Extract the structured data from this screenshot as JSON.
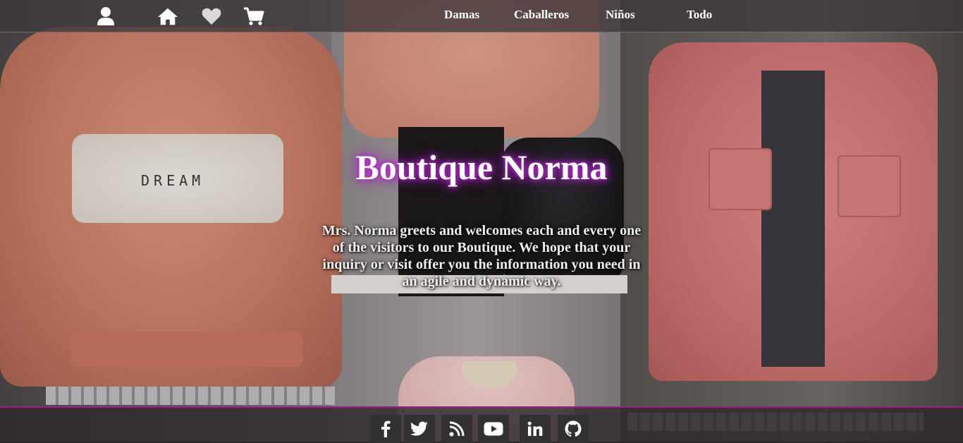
{
  "nav": {
    "icons": [
      "user-icon",
      "home-icon",
      "heart-icon",
      "cart-icon"
    ],
    "links": [
      "Damas",
      "Caballeros",
      "Niños",
      "Todo"
    ]
  },
  "hero": {
    "title": "Boutique Norma",
    "description": "Mrs. Norma greets and welcomes each and every one of the visitors to our Boutique. We hope that your inquiry or visit offer you the information you need in an agile and dynamic way."
  },
  "background": {
    "sweater_print": "DREAM"
  },
  "footer": {
    "social": [
      "facebook-icon",
      "twitter-icon",
      "rss-icon",
      "youtube-icon",
      "linkedin-icon",
      "github-icon"
    ]
  },
  "colors": {
    "accent": "#9a1e8c",
    "title_glow": "#c02ad6",
    "navbar": "#3c373a",
    "text": "#ffffff"
  }
}
